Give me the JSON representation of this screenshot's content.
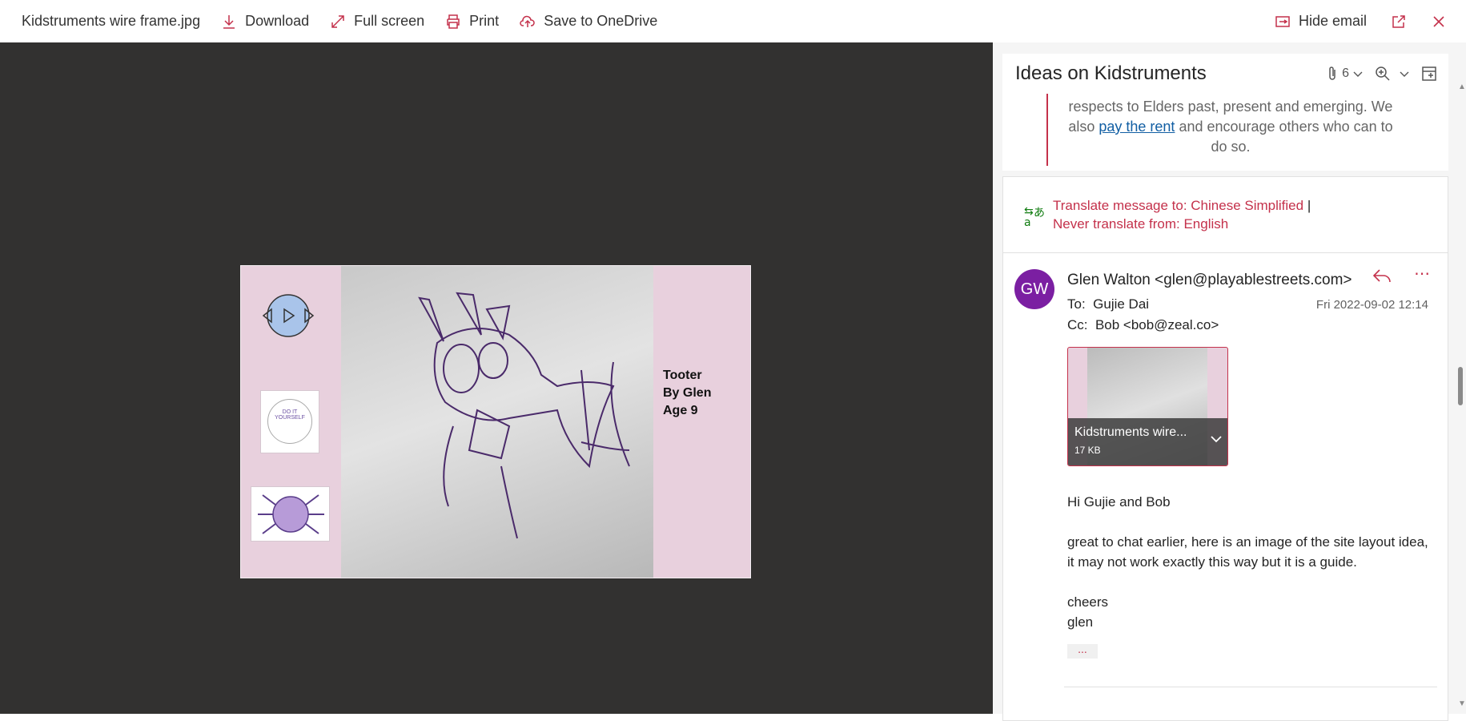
{
  "toolbar": {
    "filename": "Kidstruments wire frame.jpg",
    "download_label": "Download",
    "fullscreen_label": "Full screen",
    "print_label": "Print",
    "save_label": "Save to OneDrive",
    "hide_email_label": "Hide email"
  },
  "preview": {
    "caption": "Tooter\nBy Glen\nAge 9",
    "logo1_text": "DO IT YOURSELF"
  },
  "panel": {
    "subject": "Ideas on Kidstruments",
    "attachment_count": "6",
    "quote": {
      "text_before": "respects to Elders past, present and emerging. We also ",
      "link": "pay the rent",
      "text_after": " and encourage others who can to do so."
    },
    "translate": {
      "line1": "Translate message to: Chinese Simplified",
      "separator": "|",
      "line2": "Never translate from: English"
    },
    "message": {
      "avatar_initials": "GW",
      "from": "Glen Walton <glen@playablestreets.com>",
      "to_label": "To:",
      "to": "Gujie Dai",
      "cc_label": "Cc:",
      "cc": "Bob <bob@zeal.co>",
      "date": "Fri 2022-09-02 12:14",
      "attachment": {
        "name": "Kidstruments wire...",
        "size": "17 KB"
      },
      "body": [
        "Hi Gujie and Bob",
        "great to chat earlier, here is an image of the site layout idea, it may not work exactly this way but it is a guide.",
        "cheers\nglen"
      ],
      "ellipsis": "..."
    }
  },
  "colors": {
    "accent": "#c4314b",
    "avatar": "#7b1fa2",
    "viewer_bg": "#323130",
    "link": "#115ea3"
  }
}
